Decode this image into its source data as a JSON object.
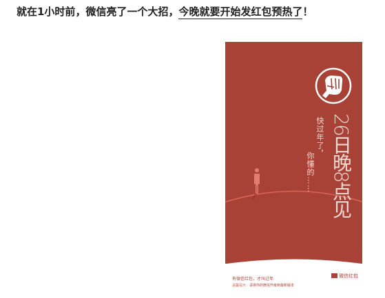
{
  "headline": {
    "text": "就在1小时前，微信亮了一个大招，",
    "link_text": "今晚就要开始发红包预热了",
    "end": "！"
  },
  "poster": {
    "background_color": "#a94236",
    "subtitle_1": "快过年了，",
    "subtitle_2": "你懂的……",
    "big_text": "26日晚8点见",
    "caption_1": "有微信红包，才叫过年",
    "caption_2_label": "温馨提示：",
    "caption_2_text": "请将你的微信升级到最新版本",
    "brand": "微信红包"
  }
}
